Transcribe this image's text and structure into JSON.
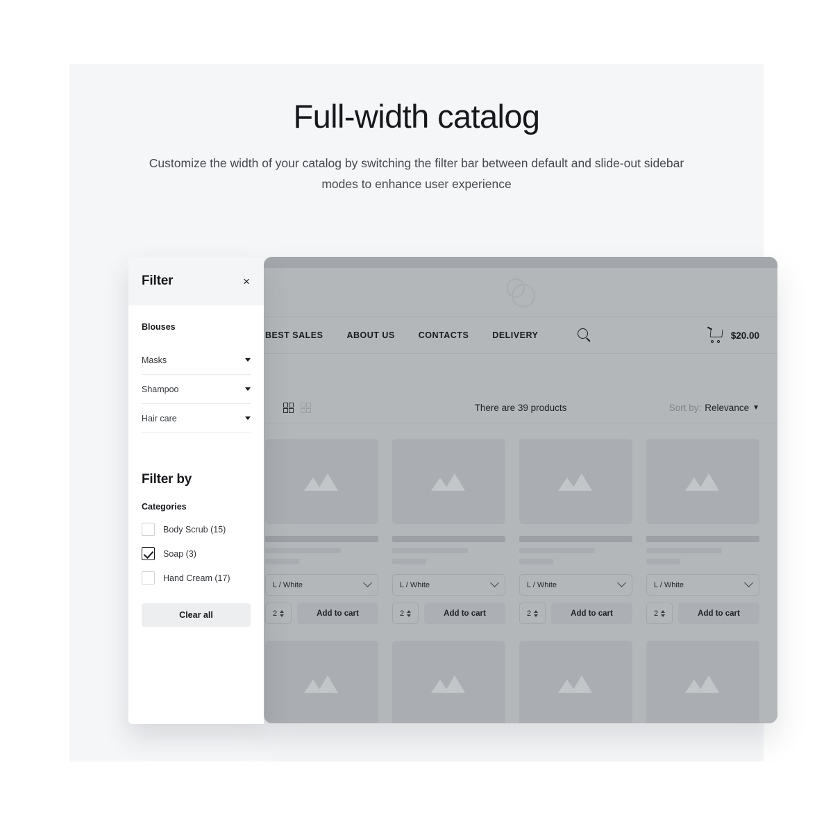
{
  "hero": {
    "title": "Full-width catalog",
    "subtitle": "Customize the width of your catalog by switching the filter bar between default and slide-out sidebar modes to enhance user experience"
  },
  "storefront": {
    "nav_links": [
      "BEST SALES",
      "ABOUT US",
      "CONTACTS",
      "DELIVERY"
    ],
    "search_icon": "search-icon",
    "cart_icon": "cart-icon",
    "cart_total": "$20.00",
    "sortbar": {
      "view_grid_icon": "grid-view-icon",
      "view_list_icon": "list-view-icon",
      "products_count": "There are 39 products",
      "sort_label": "Sort by:",
      "sort_value": "Relevance",
      "sort_caret": "chevron-down-icon"
    },
    "product": {
      "variant": "L / White",
      "quantity": "2",
      "add_to_cart": "Add to cart"
    },
    "product_cards": [
      {
        "variant": "L / White",
        "quantity": "2",
        "add_to_cart": "Add to cart"
      },
      {
        "variant": "L / White",
        "quantity": "2",
        "add_to_cart": "Add to cart"
      },
      {
        "variant": "L / White",
        "quantity": "2",
        "add_to_cart": "Add to cart"
      },
      {
        "variant": "L / White",
        "quantity": "2",
        "add_to_cart": "Add to cart"
      }
    ]
  },
  "filter_panel": {
    "title": "Filter",
    "close_label": "×",
    "category_heading": "Blouses",
    "accordions": [
      {
        "label": "Masks"
      },
      {
        "label": "Shampoo"
      },
      {
        "label": "Hair care"
      }
    ],
    "filter_by_title": "Filter by",
    "filter_by_sub": "Categories",
    "checkboxes": [
      {
        "label": "Body Scrub (15)",
        "checked": false
      },
      {
        "label": "Soap (3)",
        "checked": true
      },
      {
        "label": "Hand Cream (17)",
        "checked": false
      }
    ],
    "clear_all": "Clear all"
  },
  "colors": {
    "page_bg": "#ffffff",
    "panel_bg": "#f5f6f8",
    "mockup_bg": "#b4b7ba",
    "mockup_chrome": "#a3a6aa",
    "text_dark": "#16181c",
    "text_muted": "#45484d"
  }
}
